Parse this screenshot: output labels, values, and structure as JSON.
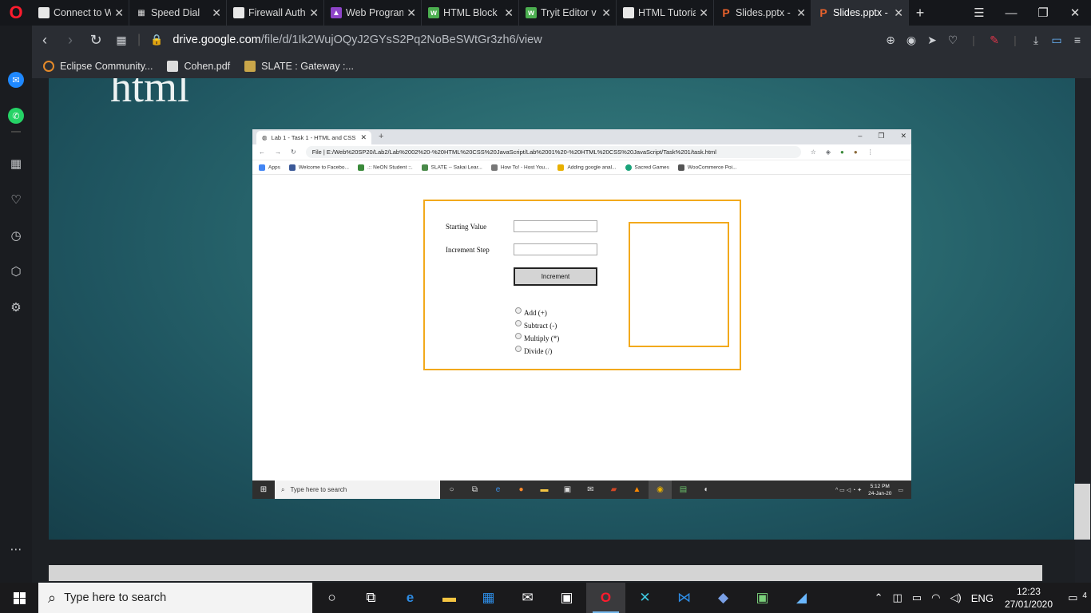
{
  "browser": {
    "tabs": [
      {
        "label": "Connect to W",
        "icon": "file-icon",
        "color": "#e8e8e8"
      },
      {
        "label": "Speed Dial",
        "icon": "speed-dial-icon",
        "color": "#e8e8e8"
      },
      {
        "label": "Firewall Auth",
        "icon": "file-icon",
        "color": "#e8e8e8"
      },
      {
        "label": "Web Program",
        "icon": "classroom-icon",
        "color": "#8e44c8"
      },
      {
        "label": "HTML Block",
        "icon": "w3-icon",
        "color": "#4caf50"
      },
      {
        "label": "Tryit Editor v",
        "icon": "w3-icon",
        "color": "#4caf50"
      },
      {
        "label": "HTML Tutoria",
        "icon": "file-icon",
        "color": "#e8e8e8"
      },
      {
        "label": "Slides.pptx -",
        "icon": "ppt-icon",
        "color": "#d24726"
      },
      {
        "label": "Slides.pptx -",
        "icon": "ppt-icon",
        "color": "#d24726"
      }
    ],
    "url_domain": "drive.google.com",
    "url_path": "/file/d/1Ik2WujOQyJ2GYsS2Pq2NoBeSWtGr3zh6/view",
    "bookmarks": [
      {
        "label": "Eclipse Community..."
      },
      {
        "label": "Cohen.pdf"
      },
      {
        "label": "SLATE : Gateway :..."
      }
    ]
  },
  "slide": {
    "title": "html",
    "inner": {
      "tab_title": "Lab 1 - Task 1 - HTML and CSS",
      "url": "File | E:/Web%20SP20/Lab2/Lab%2002%20-%20HTML%20CSS%20JavaScript/Lab%2001%20-%20HTML%20CSS%20JavaScript/Task%201/task.html",
      "bookmarks": [
        "Apps",
        "Welcome to Facebo...",
        ".:: NeON Student ::.",
        "SLATE -- Sakai Lear...",
        "How To! - Host You...",
        "Adding google anal...",
        "Sacred Games",
        "WooCommerce Poi..."
      ],
      "form": {
        "starting_label": "Starting Value",
        "step_label": "Increment Step",
        "button_label": "Increment",
        "radios": [
          "Add (+)",
          "Subtract (-)",
          "Multiply (*)",
          "Divide (/)"
        ]
      },
      "taskbar": {
        "search_placeholder": "Type here to search",
        "time": "5:12 PM",
        "date": "24-Jan-20"
      }
    }
  },
  "taskbar": {
    "search_placeholder": "Type here to search",
    "lang": "ENG",
    "time": "12:23",
    "date": "27/01/2020",
    "notifications": "4"
  }
}
